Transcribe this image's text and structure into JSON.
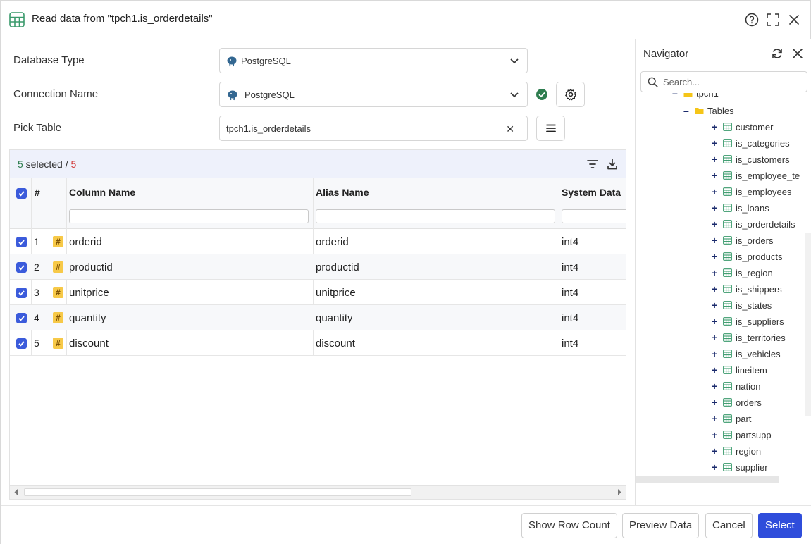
{
  "header": {
    "title": "Read data from \"tpch1.is_orderdetails\""
  },
  "form": {
    "database_type_label": "Database Type",
    "database_type_value": "PostgreSQL",
    "connection_name_label": "Connection Name",
    "connection_name_value": "PostgreSQL",
    "pick_table_label": "Pick Table",
    "pick_table_value": "tpch1.is_orderdetails",
    "clear_glyph": "✕"
  },
  "grid": {
    "selected_count": "5",
    "selected_text": " selected / ",
    "total_count": "5",
    "headers": {
      "number": "#",
      "column_name": "Column Name",
      "alias_name": "Alias Name",
      "system_data": "System Data"
    },
    "type_badge": "#",
    "rows": [
      {
        "num": "1",
        "column": "orderid",
        "alias": "orderid",
        "type": "int4"
      },
      {
        "num": "2",
        "column": "productid",
        "alias": "productid",
        "type": "int4"
      },
      {
        "num": "3",
        "column": "unitprice",
        "alias": "unitprice",
        "type": "int4"
      },
      {
        "num": "4",
        "column": "quantity",
        "alias": "quantity",
        "type": "int4"
      },
      {
        "num": "5",
        "column": "discount",
        "alias": "discount",
        "type": "int4"
      }
    ]
  },
  "navigator": {
    "title": "Navigator",
    "search_placeholder": "Search...",
    "schema_label": "tpch1",
    "tables_label": "Tables",
    "tables": [
      "customer",
      "is_categories",
      "is_customers",
      "is_employee_te",
      "is_employees",
      "is_loans",
      "is_orderdetails",
      "is_orders",
      "is_products",
      "is_region",
      "is_shippers",
      "is_states",
      "is_suppliers",
      "is_territories",
      "is_vehicles",
      "lineitem",
      "nation",
      "orders",
      "part",
      "partsupp",
      "region",
      "supplier"
    ]
  },
  "footer": {
    "show_row_count": "Show Row Count",
    "preview_data": "Preview Data",
    "cancel": "Cancel",
    "select": "Select"
  },
  "colors": {
    "accent": "#2f4ddb",
    "checkbox": "#3b5bdb",
    "table_icon": "#3a9a6c",
    "folder": "#f5c518",
    "ok": "#2e7d4f",
    "total_red": "#d23c3c"
  }
}
